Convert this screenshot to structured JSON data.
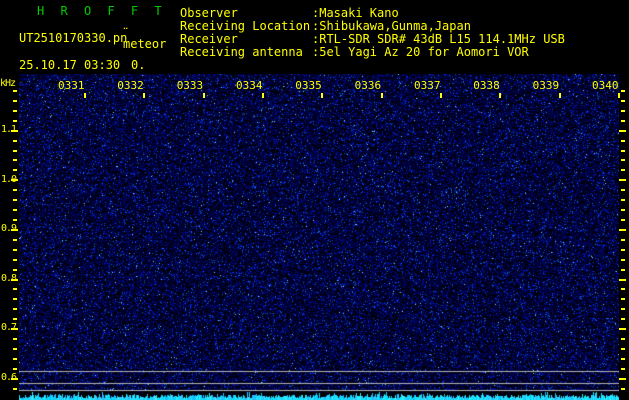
{
  "header": {
    "title": "H  R  O  F  F  T",
    "filename": "UT2510170330.pn",
    "filename_marks": "¨",
    "mode": "meteor",
    "datetime": "25.10.17 03:30",
    "count": "0.",
    "fields": [
      {
        "label": "Observer",
        "value": ":Masaki Kano"
      },
      {
        "label": "Receiving Location",
        "value": ":Shibukawa,Gunma,Japan"
      },
      {
        "label": "Receiver",
        "value": ":RTL-SDR SDR# 43dB L15 114.1MHz USB"
      },
      {
        "label": "Receiving antenna",
        "value": ":5el Yagi Az 20 for Aomori VOR"
      }
    ]
  },
  "spectrogram": {
    "freq_unit": "kHz",
    "freq_axis": {
      "labels": [
        "1.1",
        "1.0",
        "0.9",
        "0.8",
        "0.7",
        "0.6"
      ]
    },
    "time_axis": {
      "labels": [
        "0331",
        "0332",
        "0333",
        "0334",
        "0335",
        "0336",
        "0337",
        "0338",
        "0339",
        "0340"
      ]
    },
    "colors": {
      "text_yellow": "#ffff00",
      "title_green": "#00cc00",
      "grid_gray": "#b4b4b4",
      "noise_blue": "#2233cc",
      "level_cyan": "#44e9ff",
      "background": "#000000"
    }
  }
}
